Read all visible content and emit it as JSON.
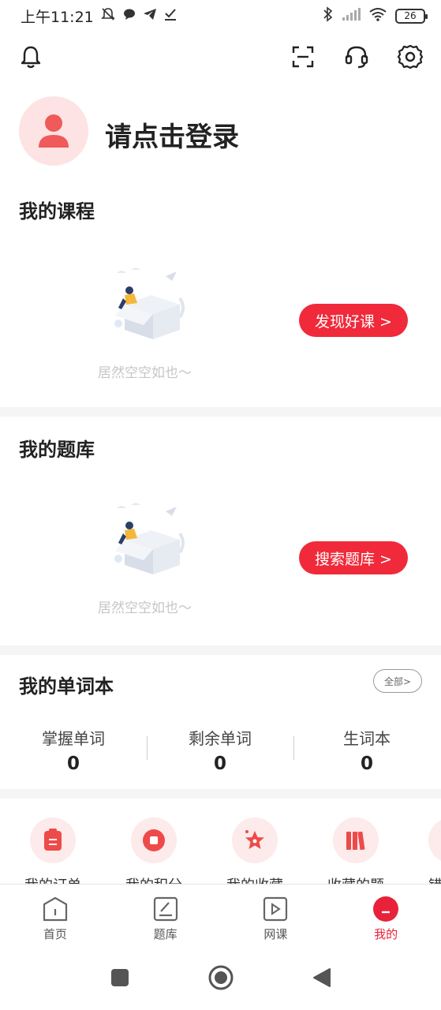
{
  "status_bar": {
    "time": "上午11:21",
    "battery": "26"
  },
  "profile": {
    "login_prompt": "请点击登录"
  },
  "my_courses": {
    "title": "我的课程",
    "empty_text": "居然空空如也～",
    "button_label": "发现好课 >"
  },
  "my_question_bank": {
    "title": "我的题库",
    "empty_text": "居然空空如也～",
    "button_label": "搜索题库 >"
  },
  "vocab": {
    "title": "我的单词本",
    "all_label": "全部>",
    "stats": [
      {
        "label": "掌握单词",
        "value": "0"
      },
      {
        "label": "剩余单词",
        "value": "0"
      },
      {
        "label": "生词本",
        "value": "0"
      }
    ]
  },
  "menu": {
    "items": [
      {
        "label": "我的订单",
        "icon": "order-icon"
      },
      {
        "label": "我的积分",
        "icon": "points-icon"
      },
      {
        "label": "我的收藏",
        "icon": "favorite-star-icon"
      },
      {
        "label": "收藏的题",
        "icon": "books-icon"
      },
      {
        "label": "错",
        "icon": "more-icon"
      }
    ]
  },
  "tabbar": {
    "tabs": [
      {
        "label": "首页",
        "icon": "home-icon"
      },
      {
        "label": "题库",
        "icon": "question-bank-icon"
      },
      {
        "label": "网课",
        "icon": "video-course-icon"
      },
      {
        "label": "我的",
        "icon": "profile-icon",
        "active": true
      }
    ]
  },
  "colors": {
    "accent": "#f02a3a",
    "avatar_bg": "#fde3e3",
    "muted_text": "#c6c6c6"
  }
}
